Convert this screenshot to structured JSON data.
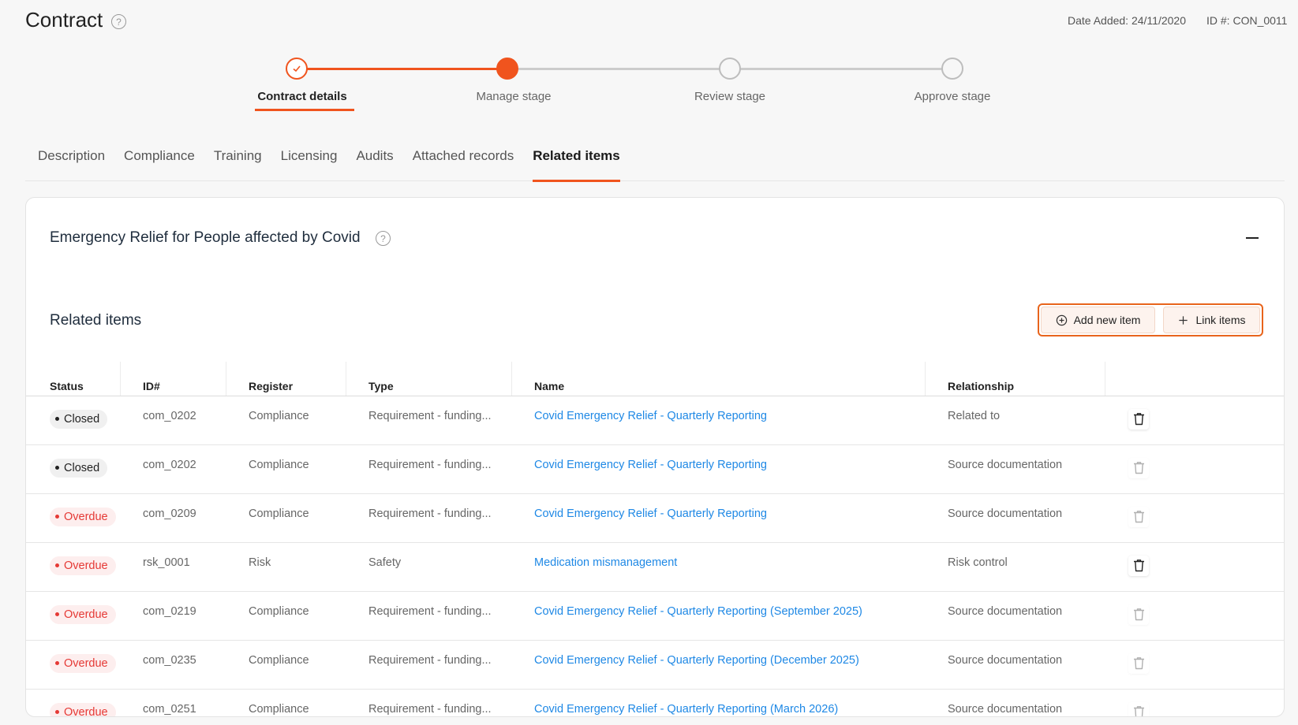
{
  "header": {
    "title": "Contract",
    "help": "?",
    "date_added": "Date Added: 24/11/2020",
    "id": "ID #: CON_0011"
  },
  "stepper": {
    "steps": [
      {
        "label": "Contract details",
        "state": "done"
      },
      {
        "label": "Manage stage",
        "state": "active"
      },
      {
        "label": "Review stage",
        "state": "pending"
      },
      {
        "label": "Approve stage",
        "state": "pending"
      }
    ]
  },
  "tabs": [
    {
      "label": "Description"
    },
    {
      "label": "Compliance"
    },
    {
      "label": "Training"
    },
    {
      "label": "Licensing"
    },
    {
      "label": "Audits"
    },
    {
      "label": "Attached records"
    },
    {
      "label": "Related items",
      "active": true
    }
  ],
  "card": {
    "title": "Emergency Relief for People affected by Covid",
    "help": "?",
    "section_title": "Related items",
    "add_button": "Add new item",
    "link_button": "Link items"
  },
  "table": {
    "columns": [
      "Status",
      "ID#",
      "Register",
      "Type",
      "Name",
      "Relationship"
    ],
    "rows": [
      {
        "status": "Closed",
        "status_kind": "closed",
        "id": "com_0202",
        "register": "Compliance",
        "type": "Requirement - funding...",
        "name": "Covid Emergency Relief - Quarterly Reporting",
        "relationship": "Related to",
        "delete_enabled": true
      },
      {
        "status": "Closed",
        "status_kind": "closed",
        "id": "com_0202",
        "register": "Compliance",
        "type": "Requirement - funding...",
        "name": "Covid Emergency Relief - Quarterly Reporting",
        "relationship": "Source documentation",
        "delete_enabled": false
      },
      {
        "status": "Overdue",
        "status_kind": "overdue",
        "id": "com_0209",
        "register": "Compliance",
        "type": "Requirement - funding...",
        "name": "Covid Emergency Relief - Quarterly Reporting",
        "relationship": "Source documentation",
        "delete_enabled": false
      },
      {
        "status": "Overdue",
        "status_kind": "overdue",
        "id": "rsk_0001",
        "register": "Risk",
        "type": "Safety",
        "name": "Medication mismanagement",
        "relationship": "Risk control",
        "delete_enabled": true
      },
      {
        "status": "Overdue",
        "status_kind": "overdue",
        "id": "com_0219",
        "register": "Compliance",
        "type": "Requirement - funding...",
        "name": "Covid Emergency Relief - Quarterly Reporting (September 2025)",
        "relationship": "Source documentation",
        "delete_enabled": false
      },
      {
        "status": "Overdue",
        "status_kind": "overdue",
        "id": "com_0235",
        "register": "Compliance",
        "type": "Requirement - funding...",
        "name": "Covid Emergency Relief - Quarterly Reporting (December 2025)",
        "relationship": "Source documentation",
        "delete_enabled": false
      },
      {
        "status": "Overdue",
        "status_kind": "overdue",
        "id": "com_0251",
        "register": "Compliance",
        "type": "Requirement - funding...",
        "name": "Covid Emergency Relief - Quarterly Reporting (March 2026)",
        "relationship": "Source documentation",
        "delete_enabled": false
      }
    ]
  },
  "colors": {
    "accent": "#f0541e",
    "link": "#1e88e5",
    "overdue": "#e53935"
  }
}
